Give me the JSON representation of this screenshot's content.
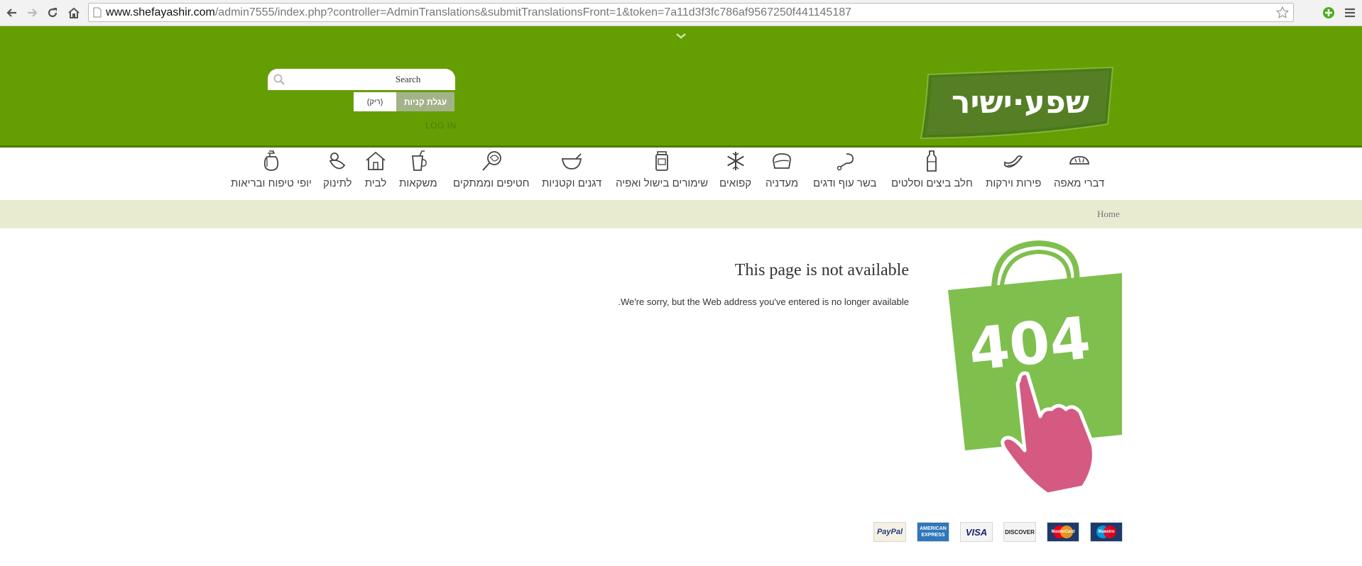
{
  "browser": {
    "url_host": "www.shefayashir.com",
    "url_path": "/admin7555/index.php?controller=AdminTranslations&submitTranslationsFront=1&token=7a11d3f3fc786af9567250f441145187"
  },
  "header": {
    "logo_text": "שפע·ישיר",
    "search_placeholder": "Search",
    "cart_label": "עגלת קניות",
    "cart_status": "(ריק)",
    "login_label": "LOG IN",
    "colors": {
      "header_green": "#659e02",
      "logo_green": "#4d7a1f"
    }
  },
  "menu": {
    "items": [
      {
        "label": "דברי מאפה",
        "icon": "bread-icon"
      },
      {
        "label": "פירות וירקות",
        "icon": "banana-icon"
      },
      {
        "label": "חלב ביצים וסלטים",
        "icon": "milk-bottle-icon"
      },
      {
        "label": "בשר עוף ודגים",
        "icon": "drumstick-icon"
      },
      {
        "label": "מעדניה",
        "icon": "sandwich-icon"
      },
      {
        "label": "קפואים",
        "icon": "snowflake-icon"
      },
      {
        "label": "שימורים בישול ואפיה",
        "icon": "jar-icon"
      },
      {
        "label": "דגנים וקטניות",
        "icon": "bowl-icon"
      },
      {
        "label": "חטיפים וממתקים",
        "icon": "lollipop-icon"
      },
      {
        "label": "משקאות",
        "icon": "cup-icon"
      },
      {
        "label": "לבית",
        "icon": "house-icon"
      },
      {
        "label": "לתינוק",
        "icon": "pacifier-icon"
      },
      {
        "label": "יופי טיפוח ובריאות",
        "icon": "lotion-bottle-icon"
      }
    ]
  },
  "breadcrumb": {
    "home": "Home"
  },
  "content": {
    "title": "This page is not available",
    "message": ".We're sorry, but the Web address you've entered is no longer available",
    "illustration_text": "404",
    "colors": {
      "bag_green": "#7fbf4d",
      "hand_pink": "#d45a82"
    }
  },
  "payment": {
    "methods": [
      {
        "name": "PayPal",
        "label": "PayPal",
        "color": "#253b80"
      },
      {
        "name": "American Express",
        "label": "AMERICAN EXPRESS",
        "color": "#2e77bb"
      },
      {
        "name": "Visa",
        "label": "VISA",
        "color": "#1a1f71"
      },
      {
        "name": "Discover",
        "label": "DISCOVER",
        "color": "#f58220"
      },
      {
        "name": "MasterCard",
        "label": "MasterCard",
        "color": "#eb001b"
      },
      {
        "name": "Maestro",
        "label": "Maestro",
        "color": "#0099df"
      }
    ]
  }
}
